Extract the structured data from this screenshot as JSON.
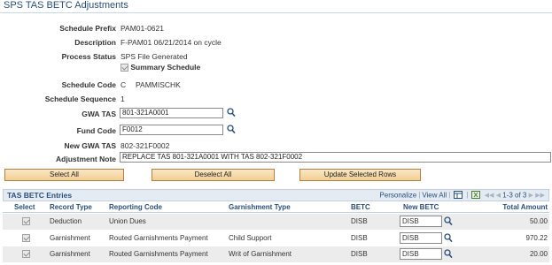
{
  "page": {
    "title": "SPS TAS BETC Adjustments"
  },
  "header_fields": {
    "schedule_prefix_label": "Schedule Prefix",
    "schedule_prefix_value": "PAM01-0621",
    "description_label": "Description",
    "description_value": "F-PAM01 06/21/2014 on cycle",
    "process_status_label": "Process Status",
    "process_status_value": "SPS File Generated",
    "summary_schedule_label": "Summary Schedule",
    "schedule_code_label": "Schedule Code",
    "schedule_code_value": "C",
    "schedule_code_user": "PAMMISCHK",
    "schedule_sequence_label": "Schedule Sequence",
    "schedule_sequence_value": "1",
    "gwa_tas_label": "GWA TAS",
    "gwa_tas_value": "801-321A0001",
    "fund_code_label": "Fund Code",
    "fund_code_value": "F0012",
    "new_gwa_tas_label": "New GWA TAS",
    "new_gwa_tas_value": "802-321F0002",
    "adjustment_note_label": "Adjustment Note",
    "adjustment_note_value": "REPLACE TAS 801-321A0001 WITH TAS 802-321F0002"
  },
  "buttons": {
    "select_all": "Select All",
    "deselect_all": "Deselect All",
    "update_selected_rows": "Update Selected Rows"
  },
  "grid": {
    "title": "TAS BETC Entries",
    "personalize": "Personalize",
    "view_all": "View All",
    "pager_text": "1-3 of 3",
    "columns": {
      "select": "Select",
      "record_type": "Record Type",
      "reporting_code": "Reporting Code",
      "garnishment_type": "Garnishment Type",
      "betc": "BETC",
      "new_betc": "New BETC",
      "total_amount": "Total Amount"
    },
    "rows": [
      {
        "record_type": "Deduction",
        "reporting_code": "Union Dues",
        "garnishment_type": "",
        "betc": "DISB",
        "new_betc": "DISB",
        "total_amount": "50.00"
      },
      {
        "record_type": "Garnishment",
        "reporting_code": "Routed Garnishments Payment",
        "garnishment_type": "Child Support",
        "betc": "DISB",
        "new_betc": "DISB",
        "total_amount": "970.22"
      },
      {
        "record_type": "Garnishment",
        "reporting_code": "Routed Garnishments Payment",
        "garnishment_type": "Writ of Garnishment",
        "betc": "DISB",
        "new_betc": "DISB",
        "total_amount": "20.00"
      }
    ]
  },
  "icons": {
    "lookup": "magnifier-icon",
    "grid_zoom": "grid-zoom-icon",
    "first": "first-page-icon",
    "prev": "prev-page-icon",
    "next": "next-page-icon",
    "last": "last-page-icon"
  },
  "colors": {
    "title_blue": "#2a4f7a",
    "button_fill": "#f2cf93",
    "button_border": "#b08040",
    "grid_header": "#e4ebf2",
    "alt_row": "#ececec"
  }
}
